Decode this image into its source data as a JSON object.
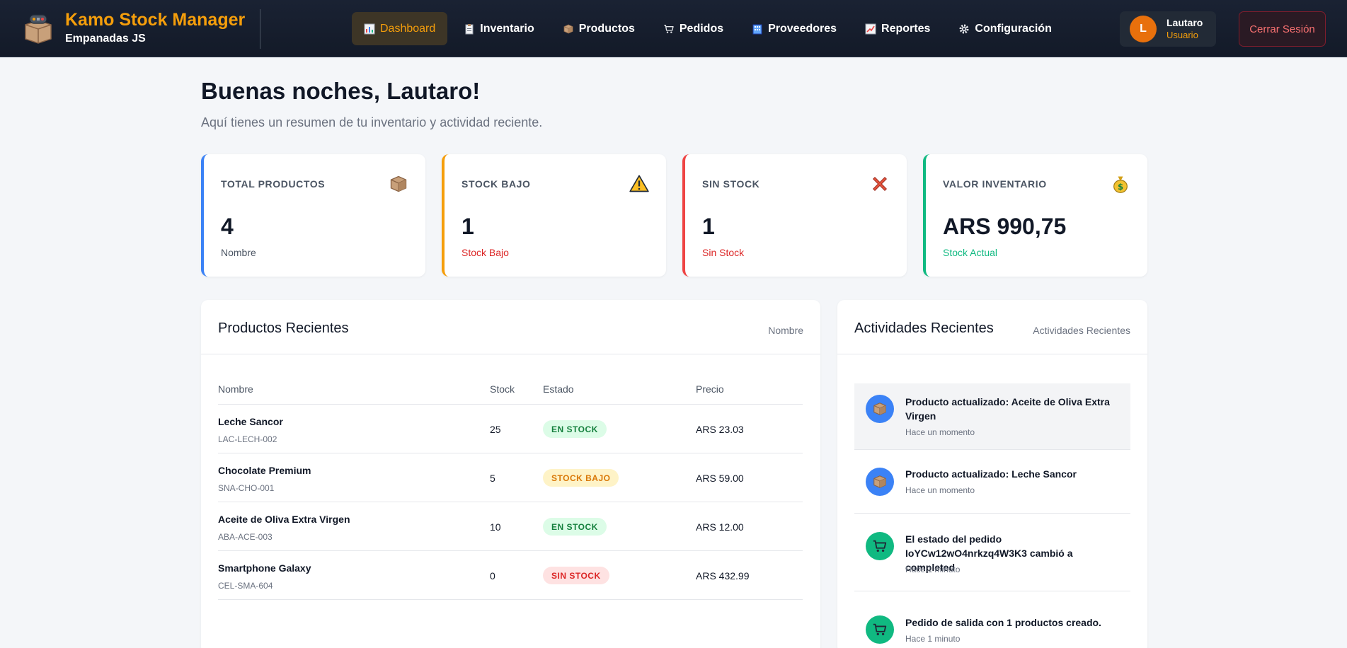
{
  "brand": {
    "title": "Kamo Stock Manager",
    "subtitle": "Empanadas JS"
  },
  "nav": [
    {
      "label": "Dashboard",
      "icon": "bar-chart-icon",
      "active": true
    },
    {
      "label": "Inventario",
      "icon": "clipboard-icon",
      "active": false
    },
    {
      "label": "Productos",
      "icon": "package-icon",
      "active": false
    },
    {
      "label": "Pedidos",
      "icon": "cart-icon",
      "active": false
    },
    {
      "label": "Proveedores",
      "icon": "building-icon",
      "active": false
    },
    {
      "label": "Reportes",
      "icon": "trend-chart-icon",
      "active": false
    },
    {
      "label": "Configuración",
      "icon": "gear-icon",
      "active": false
    }
  ],
  "user": {
    "initial": "L",
    "name": "Lautaro",
    "role": "Usuario"
  },
  "logout_label": "Cerrar Sesión",
  "greeting": "Buenas noches, Lautaro!",
  "subtitle": "Aquí tienes un resumen de tu inventario y actividad reciente.",
  "stats": [
    {
      "label": "TOTAL PRODUCTOS",
      "value": "4",
      "foot": "Nombre",
      "icon": "package-icon",
      "color": "#3b82f6",
      "foot_color": "#4b5563"
    },
    {
      "label": "STOCK BAJO",
      "value": "1",
      "foot": "Stock Bajo",
      "icon": "warning-icon",
      "color": "#f59e0b",
      "foot_color": "#dc2626"
    },
    {
      "label": "SIN STOCK",
      "value": "1",
      "foot": "Sin Stock",
      "icon": "cross-icon",
      "color": "#ef4444",
      "foot_color": "#dc2626"
    },
    {
      "label": "VALOR INVENTARIO",
      "value": "ARS 990,75",
      "foot": "Stock Actual",
      "icon": "money-bag-icon",
      "color": "#10b981",
      "foot_color": "#10b981"
    }
  ],
  "products_panel": {
    "title": "Productos Recientes",
    "link": "Nombre",
    "columns": [
      "Nombre",
      "Stock",
      "Estado",
      "Precio"
    ],
    "rows": [
      {
        "name": "Leche Sancor",
        "sku": "LAC-LECH-002",
        "stock": "25",
        "status": "EN STOCK",
        "status_type": "ok",
        "price": "ARS 23.03"
      },
      {
        "name": "Chocolate Premium",
        "sku": "SNA-CHO-001",
        "stock": "5",
        "status": "STOCK BAJO",
        "status_type": "low",
        "price": "ARS 59.00"
      },
      {
        "name": "Aceite de Oliva Extra Virgen",
        "sku": "ABA-ACE-003",
        "stock": "10",
        "status": "EN STOCK",
        "status_type": "ok",
        "price": "ARS 12.00"
      },
      {
        "name": "Smartphone Galaxy",
        "sku": "CEL-SMA-604",
        "stock": "0",
        "status": "SIN STOCK",
        "status_type": "out",
        "price": "ARS 432.99"
      }
    ]
  },
  "status_colors": {
    "ok": {
      "bg": "#dcfce7",
      "fg": "#15803d"
    },
    "low": {
      "bg": "#fef3c7",
      "fg": "#d97706"
    },
    "out": {
      "bg": "#fee2e2",
      "fg": "#dc2626"
    }
  },
  "activities_panel": {
    "title": "Actividades Recientes",
    "link": "Actividades Recientes",
    "items": [
      {
        "text": "Producto actualizado: Aceite de Oliva Extra Virgen",
        "time": "Hace un momento",
        "icon": "package-icon",
        "color": "#3b82f6",
        "highlight": true
      },
      {
        "text": "Producto actualizado: Leche Sancor",
        "time": "Hace un momento",
        "icon": "package-icon",
        "color": "#3b82f6",
        "highlight": false
      },
      {
        "text": "El estado del pedido IoYCw12wO4nrkzq4W3K3 cambió a completed",
        "time": "Hace 1 minuto",
        "icon": "cart-icon",
        "color": "#10b981",
        "highlight": false
      },
      {
        "text": "Pedido de salida con 1 productos creado.",
        "time": "Hace 1 minuto",
        "icon": "cart-icon",
        "color": "#10b981",
        "highlight": false
      }
    ]
  }
}
